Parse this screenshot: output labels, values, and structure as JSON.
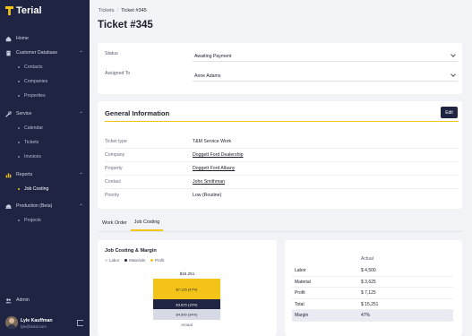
{
  "app": {
    "name": "Terial"
  },
  "sidebar": {
    "home": "Home",
    "customer_database": "Customer Database",
    "contacts": "Contacts",
    "companies": "Companies",
    "properties": "Properties",
    "service": "Service",
    "calendar": "Calendar",
    "tickets": "Tickets",
    "invoices": "Invoices",
    "reports": "Reports",
    "job_costing": "Job Costing",
    "production": "Production (Beta)",
    "projects": "Projects",
    "admin": "Admin"
  },
  "user": {
    "name": "Lyle Kauffman",
    "email": "lyle@terial.com"
  },
  "breadcrumb": {
    "root": "Tickets",
    "separator": "/",
    "current": "Ticket #345"
  },
  "page": {
    "title": "Ticket #345"
  },
  "status": {
    "label": "Status",
    "value": "Awaiting Payment"
  },
  "assigned": {
    "label": "Assigned To",
    "value": "Anne Adams"
  },
  "general": {
    "title": "General Information",
    "edit": "Edit",
    "rows": [
      {
        "k": "Ticket type",
        "v": "T&M Service Work"
      },
      {
        "k": "Company",
        "v": "Doggett Ford Dealership"
      },
      {
        "k": "Property",
        "v": "Doggett Ford Albany"
      },
      {
        "k": "Contact",
        "v": "John Smithman"
      },
      {
        "k": "Priority",
        "v": "Low (Routine)"
      }
    ]
  },
  "tabs": {
    "work_order": "Work Order",
    "job_costing": "Job Costing"
  },
  "job_costing": {
    "title": "Job Costing & Margin",
    "legend": {
      "labor": "Labor",
      "materials": "Materials",
      "profit": "Profit"
    },
    "total_label": "$15,251",
    "bar_profit": "$7,125 (47%)",
    "bar_materials": "$3,625 (16%)",
    "bar_labor": "$4,500 (34%)",
    "x_label": "Actual",
    "colors": {
      "labor": "#d7d9e4",
      "materials": "#1e2441",
      "profit": "#f3c317"
    }
  },
  "costs": {
    "header": "Actual",
    "rows": [
      {
        "k": "Labor",
        "v": "$ 4,500"
      },
      {
        "k": "Material",
        "v": "$ 3,625"
      },
      {
        "k": "Profit",
        "v": "$ 7,125"
      },
      {
        "k": "Total",
        "v": "$ 15,251"
      },
      {
        "k": "Margin",
        "v": "47%"
      }
    ]
  }
}
